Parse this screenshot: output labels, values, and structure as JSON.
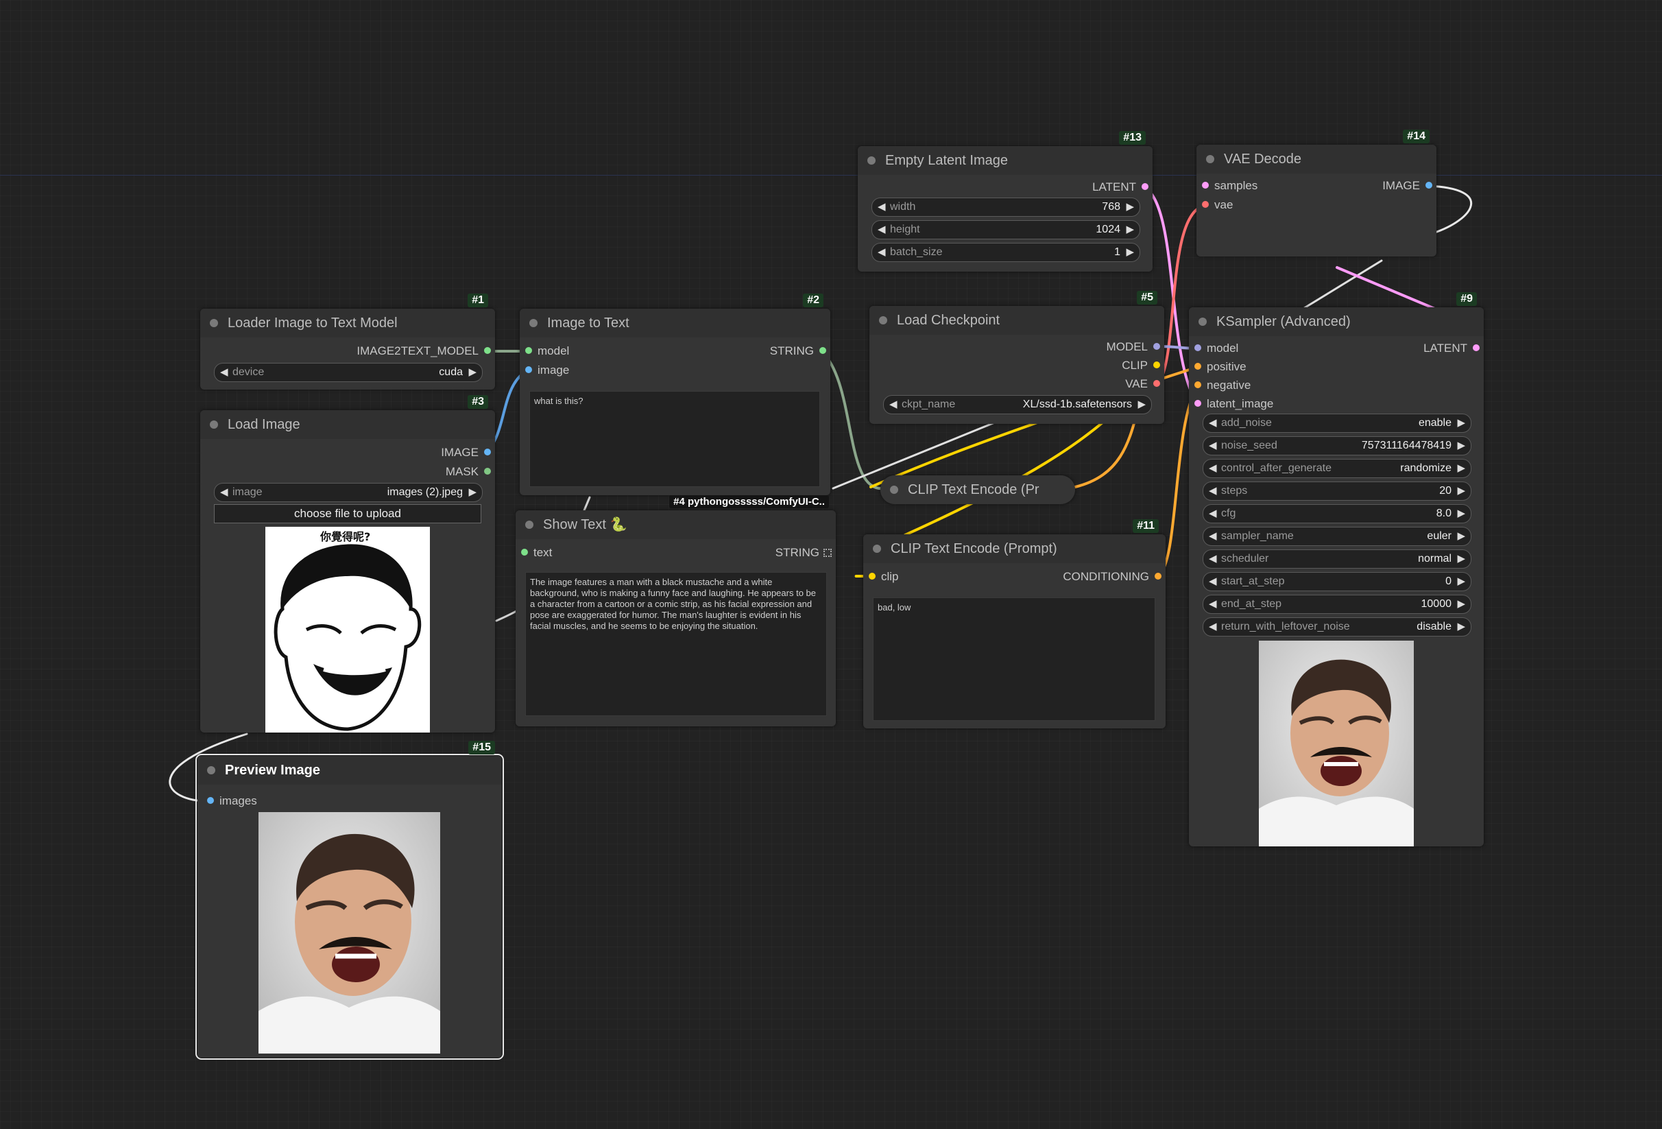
{
  "nodes": {
    "loader_model": {
      "id": "#1",
      "title": "Loader Image to Text Model",
      "output": "IMAGE2TEXT_MODEL",
      "device": {
        "label": "device",
        "value": "cuda"
      }
    },
    "image_to_text": {
      "id": "#2",
      "title": "Image to Text",
      "inputs": [
        "model",
        "image"
      ],
      "output": "STRING",
      "prompt": "what is this?"
    },
    "load_image": {
      "id": "#3",
      "title": "Load Image",
      "outputs": [
        "IMAGE",
        "MASK"
      ],
      "image": {
        "label": "image",
        "value": "images (2).jpeg"
      },
      "upload_button": "choose file to upload",
      "meme_caption": "你覺得呢?"
    },
    "show_text": {
      "id": "#4 pythongosssss/ComfyUI-C..",
      "title": "Show Text 🐍",
      "input": "text",
      "output": "STRING",
      "text": "The image features a man with a black mustache and a white background, who is making a funny face and laughing. He appears to be a character from a cartoon or a comic strip, as his facial expression and pose are exaggerated for humor. The man's laughter is evident in his facial muscles, and he seems to be enjoying the situation."
    },
    "load_checkpoint": {
      "id": "#5",
      "title": "Load Checkpoint",
      "outputs": [
        "MODEL",
        "CLIP",
        "VAE"
      ],
      "ckpt": {
        "label": "ckpt_name",
        "value": "XL/ssd-1b.safetensors"
      }
    },
    "clip_collapsed": {
      "title": "CLIP Text Encode (Pr"
    },
    "ksampler": {
      "id": "#9",
      "title": "KSampler (Advanced)",
      "inputs": [
        "model",
        "positive",
        "negative",
        "latent_image"
      ],
      "output": "LATENT",
      "widgets": [
        {
          "label": "add_noise",
          "value": "enable"
        },
        {
          "label": "noise_seed",
          "value": "757311164478419"
        },
        {
          "label": "control_after_generate",
          "value": "randomize"
        },
        {
          "label": "steps",
          "value": "20"
        },
        {
          "label": "cfg",
          "value": "8.0"
        },
        {
          "label": "sampler_name",
          "value": "euler"
        },
        {
          "label": "scheduler",
          "value": "normal"
        },
        {
          "label": "start_at_step",
          "value": "0"
        },
        {
          "label": "end_at_step",
          "value": "10000"
        },
        {
          "label": "return_with_leftover_noise",
          "value": "disable"
        }
      ]
    },
    "clip_encode": {
      "id": "#11",
      "title": "CLIP Text Encode (Prompt)",
      "input": "clip",
      "output": "CONDITIONING",
      "text": "bad, low"
    },
    "empty_latent": {
      "id": "#13",
      "title": "Empty Latent Image",
      "output": "LATENT",
      "widgets": [
        {
          "label": "width",
          "value": "768"
        },
        {
          "label": "height",
          "value": "1024"
        },
        {
          "label": "batch_size",
          "value": "1"
        }
      ]
    },
    "vae_decode": {
      "id": "#14",
      "title": "VAE Decode",
      "inputs": [
        "samples",
        "vae"
      ],
      "output": "IMAGE"
    },
    "preview": {
      "id": "#15",
      "title": "Preview Image",
      "input": "images"
    }
  },
  "colors": {
    "model": "#a1a1e0",
    "image": "#64b5f6",
    "mask": "#81c784",
    "string": "#7ee08a",
    "clip": "#ffd500",
    "vae": "#ff6e6e",
    "latent": "#ff9cf9",
    "conditioning": "#ffa931",
    "wire_white": "#e8e8e8"
  },
  "icons": [
    "arrow-left-icon",
    "arrow-right-icon",
    "node-dot-icon",
    "grip-icon"
  ]
}
